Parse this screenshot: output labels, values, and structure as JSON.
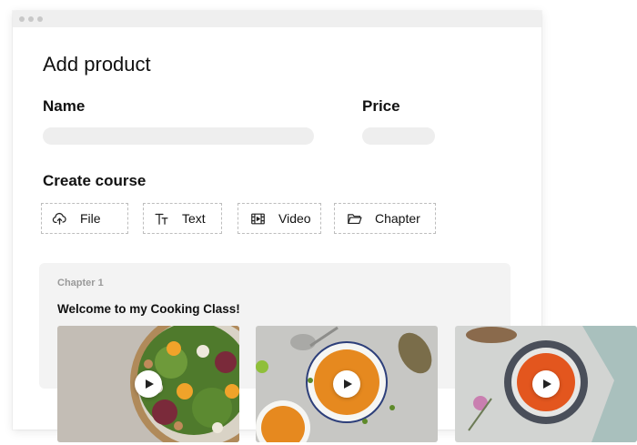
{
  "page": {
    "title": "Add product",
    "name_label": "Name",
    "price_label": "Price",
    "create_course_label": "Create course"
  },
  "toolbar": [
    {
      "label": "File",
      "icon": "cloud-upload-icon"
    },
    {
      "label": "Text",
      "icon": "text-icon"
    },
    {
      "label": "Video",
      "icon": "film-icon"
    },
    {
      "label": "Chapter",
      "icon": "folder-icon"
    }
  ],
  "chapter": {
    "number": "Chapter 1",
    "title": "Welcome to my Cooking Class!"
  },
  "videos": [
    {
      "name": "salad-video",
      "icon": "play-icon"
    },
    {
      "name": "pumpkin-soup-video",
      "icon": "play-icon"
    },
    {
      "name": "tomato-soup-video",
      "icon": "play-icon"
    }
  ],
  "colors": {
    "accent_play": "#222222",
    "card_bg": "#f3f3f3",
    "field_bg": "#eeeeee"
  }
}
